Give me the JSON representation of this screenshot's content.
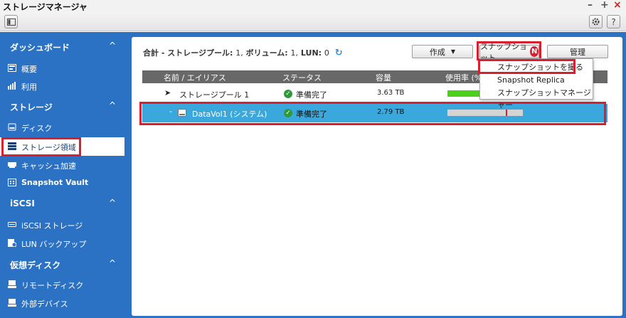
{
  "window": {
    "title": "ストレージマネージャ",
    "minimize": "–",
    "maximize": "+",
    "close": "×"
  },
  "toolbar": {
    "settings_icon": "gear-icon",
    "help_label": "?"
  },
  "sidebar": {
    "sections": [
      {
        "label": "ダッシュボード",
        "items": [
          "概要",
          "利用"
        ]
      },
      {
        "label": "ストレージ",
        "items": [
          "ディスク",
          "ストレージ領域",
          "キャッシュ加速",
          "Snapshot Vault"
        ]
      },
      {
        "label": "iSCSI",
        "items": [
          "iSCSI ストレージ",
          "LUN バックアップ"
        ]
      },
      {
        "label": "仮想ディスク",
        "items": [
          "リモートディスク",
          "外部デバイス"
        ]
      }
    ],
    "chevron": "^"
  },
  "summary": {
    "prefix": "合計 -",
    "pool_label": "ストレージプール:",
    "pool_value": "1,",
    "volume_label": "ボリューム:",
    "volume_value": "1,",
    "lun_label": "LUN:",
    "lun_value": "0"
  },
  "buttons": {
    "create": "作成",
    "snapshot": "スナップショット",
    "snapshot_badge": "N",
    "manage": "管理"
  },
  "table": {
    "columns": [
      "名前 / エイリアス",
      "ステータス",
      "容量",
      "使用率 (%)"
    ],
    "rows": [
      {
        "name": "ストレージプール 1",
        "status": "準備完了",
        "capacity": "3.63 TB",
        "usage": 0.45
      },
      {
        "name": "DataVol1 (システム)",
        "status": "準備完了",
        "capacity": "2.79 TB",
        "usage": 0.77
      }
    ]
  },
  "snapshot_menu": {
    "items": [
      "スナップショットを撮る",
      "Snapshot Replica",
      "スナップショットマネージャー"
    ]
  },
  "colors": {
    "sidebar_bg": "#2c72c4",
    "highlight": "#d62030",
    "selected_row": "#3aa8dc",
    "usage_green": "#4cd01a",
    "usage_red": "#d62030"
  }
}
